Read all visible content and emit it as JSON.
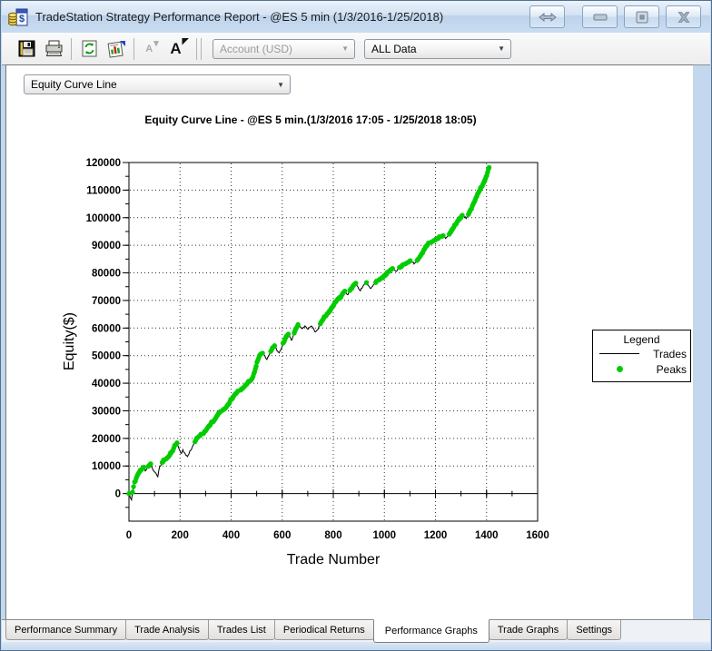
{
  "window": {
    "title": "TradeStation Strategy Performance Report - @ES 5 min (1/3/2016-1/25/2018)",
    "icon": "tradestation-report-icon",
    "buttons": [
      {
        "name": "resize-horizontal",
        "glyph": "double-arrow"
      },
      {
        "name": "minimize",
        "glyph": "bar"
      },
      {
        "name": "restore",
        "glyph": "box-in-box"
      },
      {
        "name": "close",
        "glyph": "x"
      }
    ]
  },
  "toolbar": {
    "buttons": [
      {
        "name": "save",
        "enabled": true
      },
      {
        "name": "print",
        "enabled": true
      },
      {
        "name": "refresh",
        "enabled": true
      },
      {
        "name": "report-settings",
        "enabled": true
      },
      {
        "name": "decrease-font",
        "enabled": false,
        "label": "A"
      },
      {
        "name": "increase-font",
        "enabled": true,
        "label": "A"
      }
    ],
    "account_dropdown": {
      "value": "Account (USD)",
      "disabled": true
    },
    "data_dropdown": {
      "value": "ALL Data",
      "disabled": false
    }
  },
  "graph_selector": {
    "value": "Equity Curve Line"
  },
  "legend": {
    "title": "Legend",
    "items": [
      {
        "label": "Trades",
        "marker": "line",
        "color": "#000000"
      },
      {
        "label": "Peaks",
        "marker": "dot",
        "color": "#00cc00"
      }
    ]
  },
  "tabs": {
    "active": "Performance Graphs",
    "items": [
      {
        "label": "Performance Summary"
      },
      {
        "label": "Trade Analysis"
      },
      {
        "label": "Trades List"
      },
      {
        "label": "Periodical Returns"
      },
      {
        "label": "Performance Graphs"
      },
      {
        "label": "Trade Graphs"
      },
      {
        "label": "Settings"
      }
    ]
  },
  "chart_data": {
    "type": "line",
    "title": "Equity Curve Line - @ES 5 min.(1/3/2016 17:05 - 1/25/2018 18:05)",
    "xlabel": "Trade Number",
    "ylabel": "Equity($)",
    "xlim": [
      0,
      1600
    ],
    "ylim": [
      -10000,
      120000
    ],
    "x_ticks": [
      0,
      200,
      400,
      600,
      800,
      1000,
      1200,
      1400,
      1600
    ],
    "y_ticks": [
      0,
      10000,
      20000,
      30000,
      40000,
      50000,
      60000,
      70000,
      80000,
      90000,
      100000,
      110000,
      120000
    ],
    "x_minor_step": 100,
    "y_minor_step": 5000,
    "grid": "dotted",
    "legend_position": "right",
    "series": [
      {
        "name": "Trades",
        "type": "line",
        "color": "#000000",
        "points": [
          [
            0,
            0
          ],
          [
            5,
            -1500
          ],
          [
            10,
            -2300
          ],
          [
            14,
            500
          ],
          [
            18,
            2500
          ],
          [
            22,
            4200
          ],
          [
            28,
            5500
          ],
          [
            35,
            7000
          ],
          [
            42,
            8000
          ],
          [
            50,
            8800
          ],
          [
            58,
            9600
          ],
          [
            64,
            8200
          ],
          [
            70,
            9000
          ],
          [
            78,
            10000
          ],
          [
            85,
            10800
          ],
          [
            92,
            9000
          ],
          [
            100,
            7800
          ],
          [
            108,
            7000
          ],
          [
            113,
            6100
          ],
          [
            117,
            8500
          ],
          [
            123,
            10000
          ],
          [
            130,
            11300
          ],
          [
            138,
            12000
          ],
          [
            146,
            12600
          ],
          [
            153,
            13200
          ],
          [
            160,
            14000
          ],
          [
            168,
            15200
          ],
          [
            175,
            16400
          ],
          [
            182,
            17600
          ],
          [
            188,
            18400
          ],
          [
            194,
            16800
          ],
          [
            200,
            15400
          ],
          [
            206,
            14600
          ],
          [
            211,
            15900
          ],
          [
            217,
            14900
          ],
          [
            223,
            13900
          ],
          [
            229,
            13400
          ],
          [
            235,
            14400
          ],
          [
            241,
            15600
          ],
          [
            248,
            16900
          ],
          [
            255,
            18200
          ],
          [
            262,
            19400
          ],
          [
            269,
            20300
          ],
          [
            276,
            20900
          ],
          [
            284,
            21300
          ],
          [
            292,
            21800
          ],
          [
            299,
            22600
          ],
          [
            306,
            23600
          ],
          [
            313,
            24500
          ],
          [
            320,
            25300
          ],
          [
            327,
            25900
          ],
          [
            334,
            26600
          ],
          [
            341,
            27600
          ],
          [
            348,
            28600
          ],
          [
            354,
            29300
          ],
          [
            360,
            29800
          ],
          [
            367,
            30200
          ],
          [
            374,
            30600
          ],
          [
            381,
            31300
          ],
          [
            388,
            32300
          ],
          [
            395,
            33300
          ],
          [
            402,
            34200
          ],
          [
            409,
            35200
          ],
          [
            416,
            36100
          ],
          [
            423,
            36700
          ],
          [
            430,
            37100
          ],
          [
            437,
            37500
          ],
          [
            444,
            38000
          ],
          [
            451,
            38700
          ],
          [
            458,
            39500
          ],
          [
            465,
            40200
          ],
          [
            472,
            40700
          ],
          [
            479,
            41300
          ],
          [
            486,
            42500
          ],
          [
            492,
            44200
          ],
          [
            498,
            46200
          ],
          [
            504,
            48200
          ],
          [
            510,
            49800
          ],
          [
            516,
            50600
          ],
          [
            523,
            50900
          ],
          [
            529,
            50300
          ],
          [
            535,
            49200
          ],
          [
            540,
            48600
          ],
          [
            546,
            49600
          ],
          [
            552,
            50800
          ],
          [
            558,
            52000
          ],
          [
            564,
            53000
          ],
          [
            570,
            53600
          ],
          [
            576,
            52800
          ],
          [
            582,
            51600
          ],
          [
            588,
            51000
          ],
          [
            594,
            52000
          ],
          [
            600,
            53400
          ],
          [
            606,
            54800
          ],
          [
            612,
            56200
          ],
          [
            618,
            57200
          ],
          [
            624,
            57800
          ],
          [
            630,
            56900
          ],
          [
            636,
            55600
          ],
          [
            641,
            56600
          ],
          [
            647,
            58200
          ],
          [
            653,
            59600
          ],
          [
            659,
            60600
          ],
          [
            665,
            61100
          ],
          [
            671,
            60400
          ],
          [
            677,
            59800
          ],
          [
            683,
            60300
          ],
          [
            689,
            60800
          ],
          [
            695,
            60200
          ],
          [
            701,
            59600
          ],
          [
            707,
            60100
          ],
          [
            713,
            60700
          ],
          [
            719,
            60200
          ],
          [
            725,
            59300
          ],
          [
            731,
            58600
          ],
          [
            737,
            59300
          ],
          [
            743,
            60400
          ],
          [
            749,
            61500
          ],
          [
            755,
            62500
          ],
          [
            761,
            63300
          ],
          [
            767,
            64000
          ],
          [
            773,
            64700
          ],
          [
            779,
            65400
          ],
          [
            785,
            66200
          ],
          [
            791,
            67000
          ],
          [
            797,
            67800
          ],
          [
            803,
            68600
          ],
          [
            809,
            69400
          ],
          [
            815,
            70100
          ],
          [
            821,
            70700
          ],
          [
            827,
            71100
          ],
          [
            833,
            71900
          ],
          [
            839,
            72800
          ],
          [
            845,
            73400
          ],
          [
            850,
            72700
          ],
          [
            855,
            72100
          ],
          [
            860,
            72800
          ],
          [
            865,
            73600
          ],
          [
            870,
            74300
          ],
          [
            876,
            75100
          ],
          [
            882,
            75800
          ],
          [
            888,
            76300
          ],
          [
            894,
            75200
          ],
          [
            900,
            74100
          ],
          [
            906,
            73500
          ],
          [
            912,
            74400
          ],
          [
            918,
            75400
          ],
          [
            924,
            76100
          ],
          [
            930,
            76500
          ],
          [
            936,
            75600
          ],
          [
            942,
            74800
          ],
          [
            948,
            74400
          ],
          [
            954,
            75100
          ],
          [
            960,
            75900
          ],
          [
            966,
            76500
          ],
          [
            972,
            77000
          ],
          [
            978,
            77400
          ],
          [
            984,
            77800
          ],
          [
            990,
            78200
          ],
          [
            996,
            78600
          ],
          [
            1002,
            79000
          ],
          [
            1008,
            79500
          ],
          [
            1014,
            80100
          ],
          [
            1020,
            80700
          ],
          [
            1026,
            81200
          ],
          [
            1032,
            81600
          ],
          [
            1038,
            81200
          ],
          [
            1044,
            80600
          ],
          [
            1050,
            80900
          ],
          [
            1056,
            81500
          ],
          [
            1062,
            82000
          ],
          [
            1068,
            82400
          ],
          [
            1074,
            82800
          ],
          [
            1080,
            83200
          ],
          [
            1086,
            83500
          ],
          [
            1092,
            83800
          ],
          [
            1098,
            84100
          ],
          [
            1104,
            84400
          ],
          [
            1110,
            83800
          ],
          [
            1116,
            83200
          ],
          [
            1122,
            83800
          ],
          [
            1128,
            84500
          ],
          [
            1134,
            85200
          ],
          [
            1140,
            86000
          ],
          [
            1146,
            86900
          ],
          [
            1152,
            87800
          ],
          [
            1158,
            88700
          ],
          [
            1164,
            89600
          ],
          [
            1170,
            90300
          ],
          [
            1176,
            90800
          ],
          [
            1182,
            91100
          ],
          [
            1188,
            91400
          ],
          [
            1194,
            91700
          ],
          [
            1200,
            92000
          ],
          [
            1206,
            92300
          ],
          [
            1212,
            92600
          ],
          [
            1218,
            92900
          ],
          [
            1224,
            93200
          ],
          [
            1230,
            93500
          ],
          [
            1236,
            93100
          ],
          [
            1242,
            92700
          ],
          [
            1248,
            93300
          ],
          [
            1254,
            94000
          ],
          [
            1260,
            94800
          ],
          [
            1266,
            95700
          ],
          [
            1272,
            96600
          ],
          [
            1278,
            97500
          ],
          [
            1284,
            98400
          ],
          [
            1290,
            99200
          ],
          [
            1296,
            99900
          ],
          [
            1302,
            100500
          ],
          [
            1308,
            100900
          ],
          [
            1314,
            100200
          ],
          [
            1320,
            99700
          ],
          [
            1326,
            100600
          ],
          [
            1332,
            101800
          ],
          [
            1338,
            103000
          ],
          [
            1344,
            104200
          ],
          [
            1350,
            105400
          ],
          [
            1356,
            106600
          ],
          [
            1362,
            107800
          ],
          [
            1368,
            109000
          ],
          [
            1374,
            110100
          ],
          [
            1380,
            111100
          ],
          [
            1386,
            112200
          ],
          [
            1392,
            113400
          ],
          [
            1398,
            114800
          ],
          [
            1404,
            116400
          ],
          [
            1410,
            118200
          ]
        ]
      },
      {
        "name": "Peaks",
        "type": "scatter",
        "color": "#00cc00",
        "derived": "running maximum (new equity highs) of Trades series"
      }
    ]
  }
}
